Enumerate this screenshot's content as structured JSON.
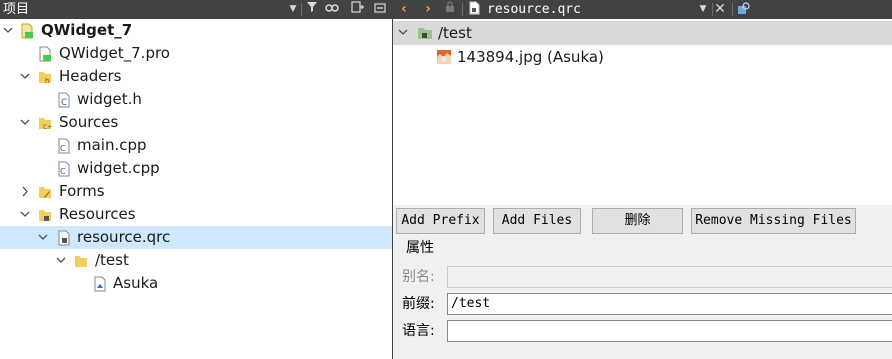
{
  "left_panel": {
    "title": "项目",
    "toolbar_icons": [
      "dropdown-icon",
      "filter-icon",
      "link-icon",
      "split-icon",
      "collapse-icon"
    ],
    "tree": [
      {
        "label": "QWidget_7",
        "bold": true,
        "expanded": true,
        "icon": "project-icon"
      },
      {
        "label": "QWidget_7.pro",
        "icon": "pro-file-icon"
      },
      {
        "label": "Headers",
        "expanded": true,
        "icon": "headers-folder-icon"
      },
      {
        "label": "widget.h",
        "icon": "header-file-icon"
      },
      {
        "label": "Sources",
        "expanded": true,
        "icon": "sources-folder-icon"
      },
      {
        "label": "main.cpp",
        "icon": "cpp-file-icon"
      },
      {
        "label": "widget.cpp",
        "icon": "cpp-file-icon"
      },
      {
        "label": "Forms",
        "expanded": false,
        "icon": "forms-folder-icon"
      },
      {
        "label": "Resources",
        "expanded": true,
        "icon": "resources-folder-icon"
      },
      {
        "label": "resource.qrc",
        "expanded": true,
        "selected": true,
        "icon": "qrc-file-icon"
      },
      {
        "label": "/test",
        "expanded": true,
        "icon": "folder-icon"
      },
      {
        "label": "Asuka",
        "icon": "image-file-icon"
      }
    ]
  },
  "editor": {
    "filename": "resource.qrc",
    "tree": [
      {
        "label": "/test",
        "expanded": true,
        "icon": "prefix-folder-icon"
      },
      {
        "label": "143894.jpg (Asuka)",
        "icon": "image-thumbnail-icon"
      }
    ],
    "buttons": {
      "add_prefix": "Add Prefix",
      "add_files": "Add Files",
      "delete": "删除",
      "remove_missing": "Remove Missing Files"
    },
    "properties": {
      "heading": "属性",
      "alias_label": "别名:",
      "alias_value": "",
      "prefix_label": "前缀:",
      "prefix_value": "/test",
      "language_label": "语言:",
      "language_value": ""
    }
  },
  "colors": {
    "toolbar_bg": "#404244",
    "selection": "#cde8ff",
    "highlight_row": "#d9d9d9",
    "nav_arrow": "#e8a91a"
  }
}
